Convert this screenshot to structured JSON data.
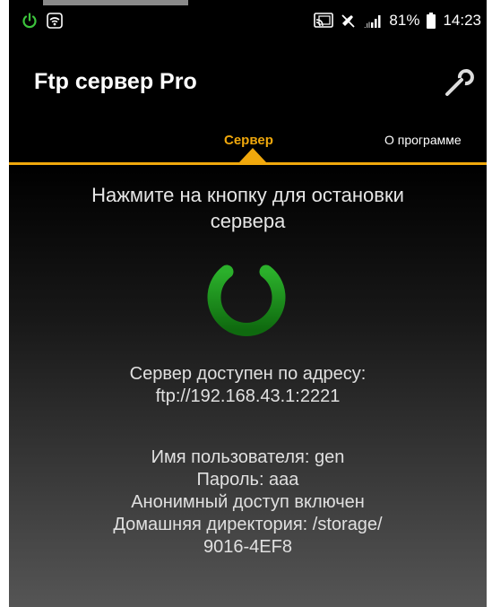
{
  "status_bar": {
    "battery": "81%",
    "time": "14:23",
    "icons": [
      "power-icon",
      "wifi-icon",
      "cast-icon",
      "mute-icon",
      "signal-icon",
      "battery-icon"
    ]
  },
  "app_bar": {
    "title": "Ftp сервер Pro",
    "settings_icon": "wrench-icon"
  },
  "tabs": [
    {
      "label": "Сервер",
      "active": true
    },
    {
      "label": "О программе",
      "active": false
    }
  ],
  "content": {
    "prompt_line1": "Нажмите на кнопку для остановки",
    "prompt_line2": "сервера",
    "power_button_color": "#1a8a1a",
    "address_label": "Сервер доступен по адресу:",
    "address": "ftp://192.168.43.1:2221",
    "username": "Имя пользователя: gen",
    "password": "Пароль: aaa",
    "anonymous": "Анонимный доступ включен",
    "home_dir_line1": "Домашняя директория: /storage/",
    "home_dir_line2": "9016-4EF8"
  },
  "colors": {
    "accent": "#f0a80c",
    "background": "#000000",
    "power_green": "#1a8a1a"
  }
}
